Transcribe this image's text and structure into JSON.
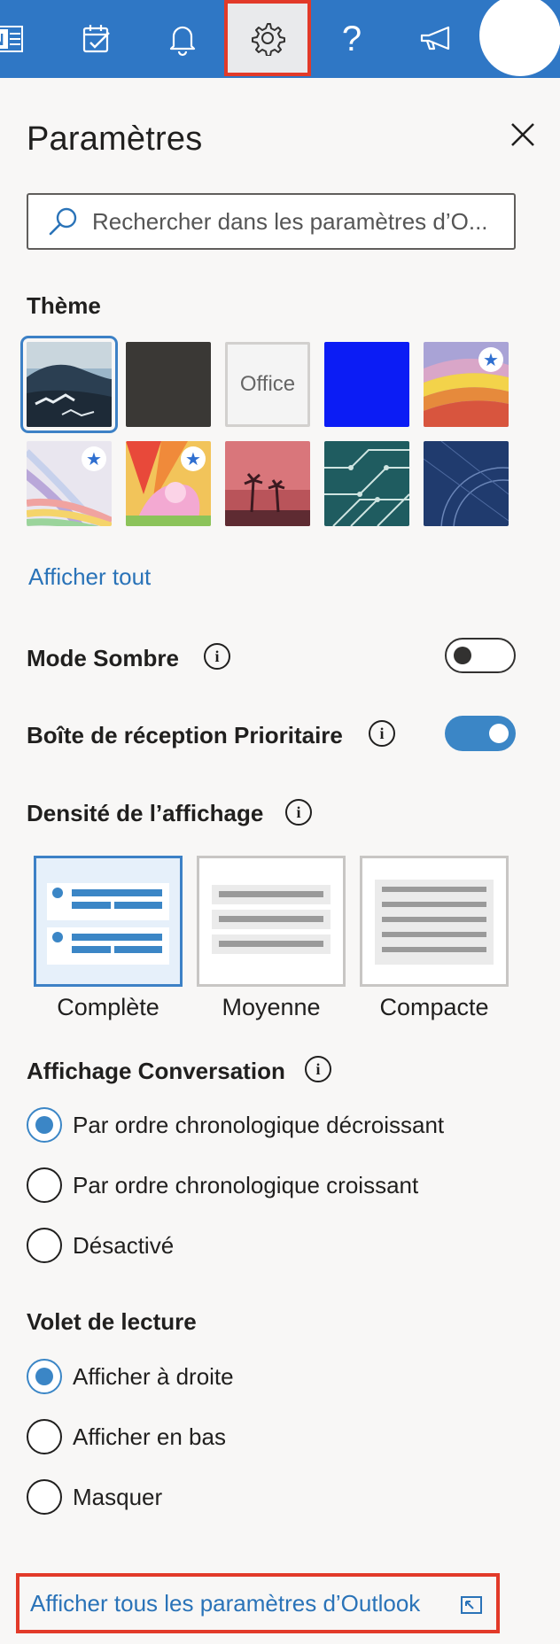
{
  "topbar": {
    "icons": [
      "onenote-icon",
      "todo-icon",
      "bell-icon",
      "gear-icon",
      "help-icon",
      "megaphone-icon"
    ],
    "onenote_letter": "N",
    "help_glyph": "?",
    "accent": "#2f77c5",
    "highlight": "#e23a29"
  },
  "settings": {
    "title": "Paramètres",
    "search_placeholder": "Rechercher dans les paramètres d’O...",
    "theme_label": "Thème",
    "themes": [
      {
        "name": "theme-mountain",
        "selected": true,
        "premium": false
      },
      {
        "name": "theme-dark-gray",
        "selected": false,
        "premium": false
      },
      {
        "name": "theme-office",
        "selected": false,
        "premium": false,
        "label": "Office"
      },
      {
        "name": "theme-blue",
        "selected": false,
        "premium": false
      },
      {
        "name": "theme-rainbow-stripes",
        "selected": false,
        "premium": true
      },
      {
        "name": "theme-ribbons",
        "selected": false,
        "premium": true
      },
      {
        "name": "theme-unicorn",
        "selected": false,
        "premium": true
      },
      {
        "name": "theme-palms",
        "selected": false,
        "premium": false
      },
      {
        "name": "theme-circuit",
        "selected": false,
        "premium": false
      },
      {
        "name": "theme-blueprint",
        "selected": false,
        "premium": false
      }
    ],
    "show_all": "Afficher tout",
    "dark_mode": {
      "label": "Mode Sombre",
      "on": false
    },
    "focused_inbox": {
      "label": "Boîte de réception Prioritaire",
      "on": true
    },
    "density": {
      "label": "Densité de l’affichage",
      "options": [
        {
          "label": "Complète",
          "selected": true
        },
        {
          "label": "Moyenne",
          "selected": false
        },
        {
          "label": "Compacte",
          "selected": false
        }
      ]
    },
    "conversation": {
      "label": "Affichage Conversation",
      "options": [
        {
          "label": "Par ordre chronologique décroissant",
          "checked": true
        },
        {
          "label": "Par ordre chronologique croissant",
          "checked": false
        },
        {
          "label": "Désactivé",
          "checked": false
        }
      ]
    },
    "reading_pane": {
      "label": "Volet de lecture",
      "options": [
        {
          "label": "Afficher à droite",
          "checked": true
        },
        {
          "label": "Afficher en bas",
          "checked": false
        },
        {
          "label": "Masquer",
          "checked": false
        }
      ]
    },
    "all_settings_link": "Afficher tous les paramètres d’Outlook",
    "info_glyph": "i"
  }
}
